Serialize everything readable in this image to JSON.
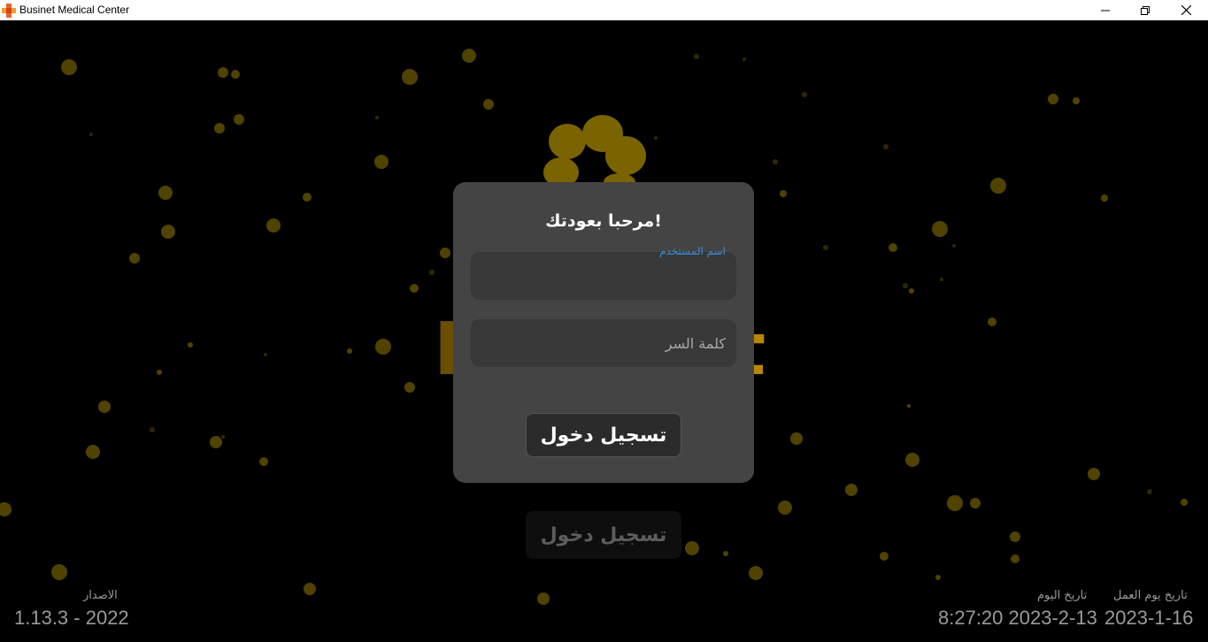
{
  "window": {
    "title": "Businet Medical Center",
    "icon": "medical-cross-icon",
    "controls": {
      "minimize": "minimize-icon",
      "maximize": "restore-icon",
      "close": "close-icon"
    }
  },
  "background": {
    "brand_fragment_left": "I",
    "brand_fragment_right": "t",
    "ghost_login_label": "تسجيل دخول",
    "accent_color": "#c9a200"
  },
  "dialog": {
    "title": "!مرحبا بعودتك",
    "username": {
      "label": "اسم المستخدم",
      "value": ""
    },
    "password": {
      "placeholder": "كلمة السر",
      "value": ""
    },
    "login_label": "تسجيل دخول"
  },
  "footer": {
    "version_label": "الاصدار",
    "version_value": "1.13.3 - 2022",
    "today_label": "تاريخ اليوم",
    "today_value": "8:27:20 2023-2-13",
    "workday_label": "تاريخ يوم العمل",
    "workday_value": "2023-1-16"
  },
  "colors": {
    "background": "#000000",
    "dialog": "#444444",
    "field": "#383838",
    "field_label": "#3a8fd8",
    "bokeh": "#6b5a00"
  }
}
